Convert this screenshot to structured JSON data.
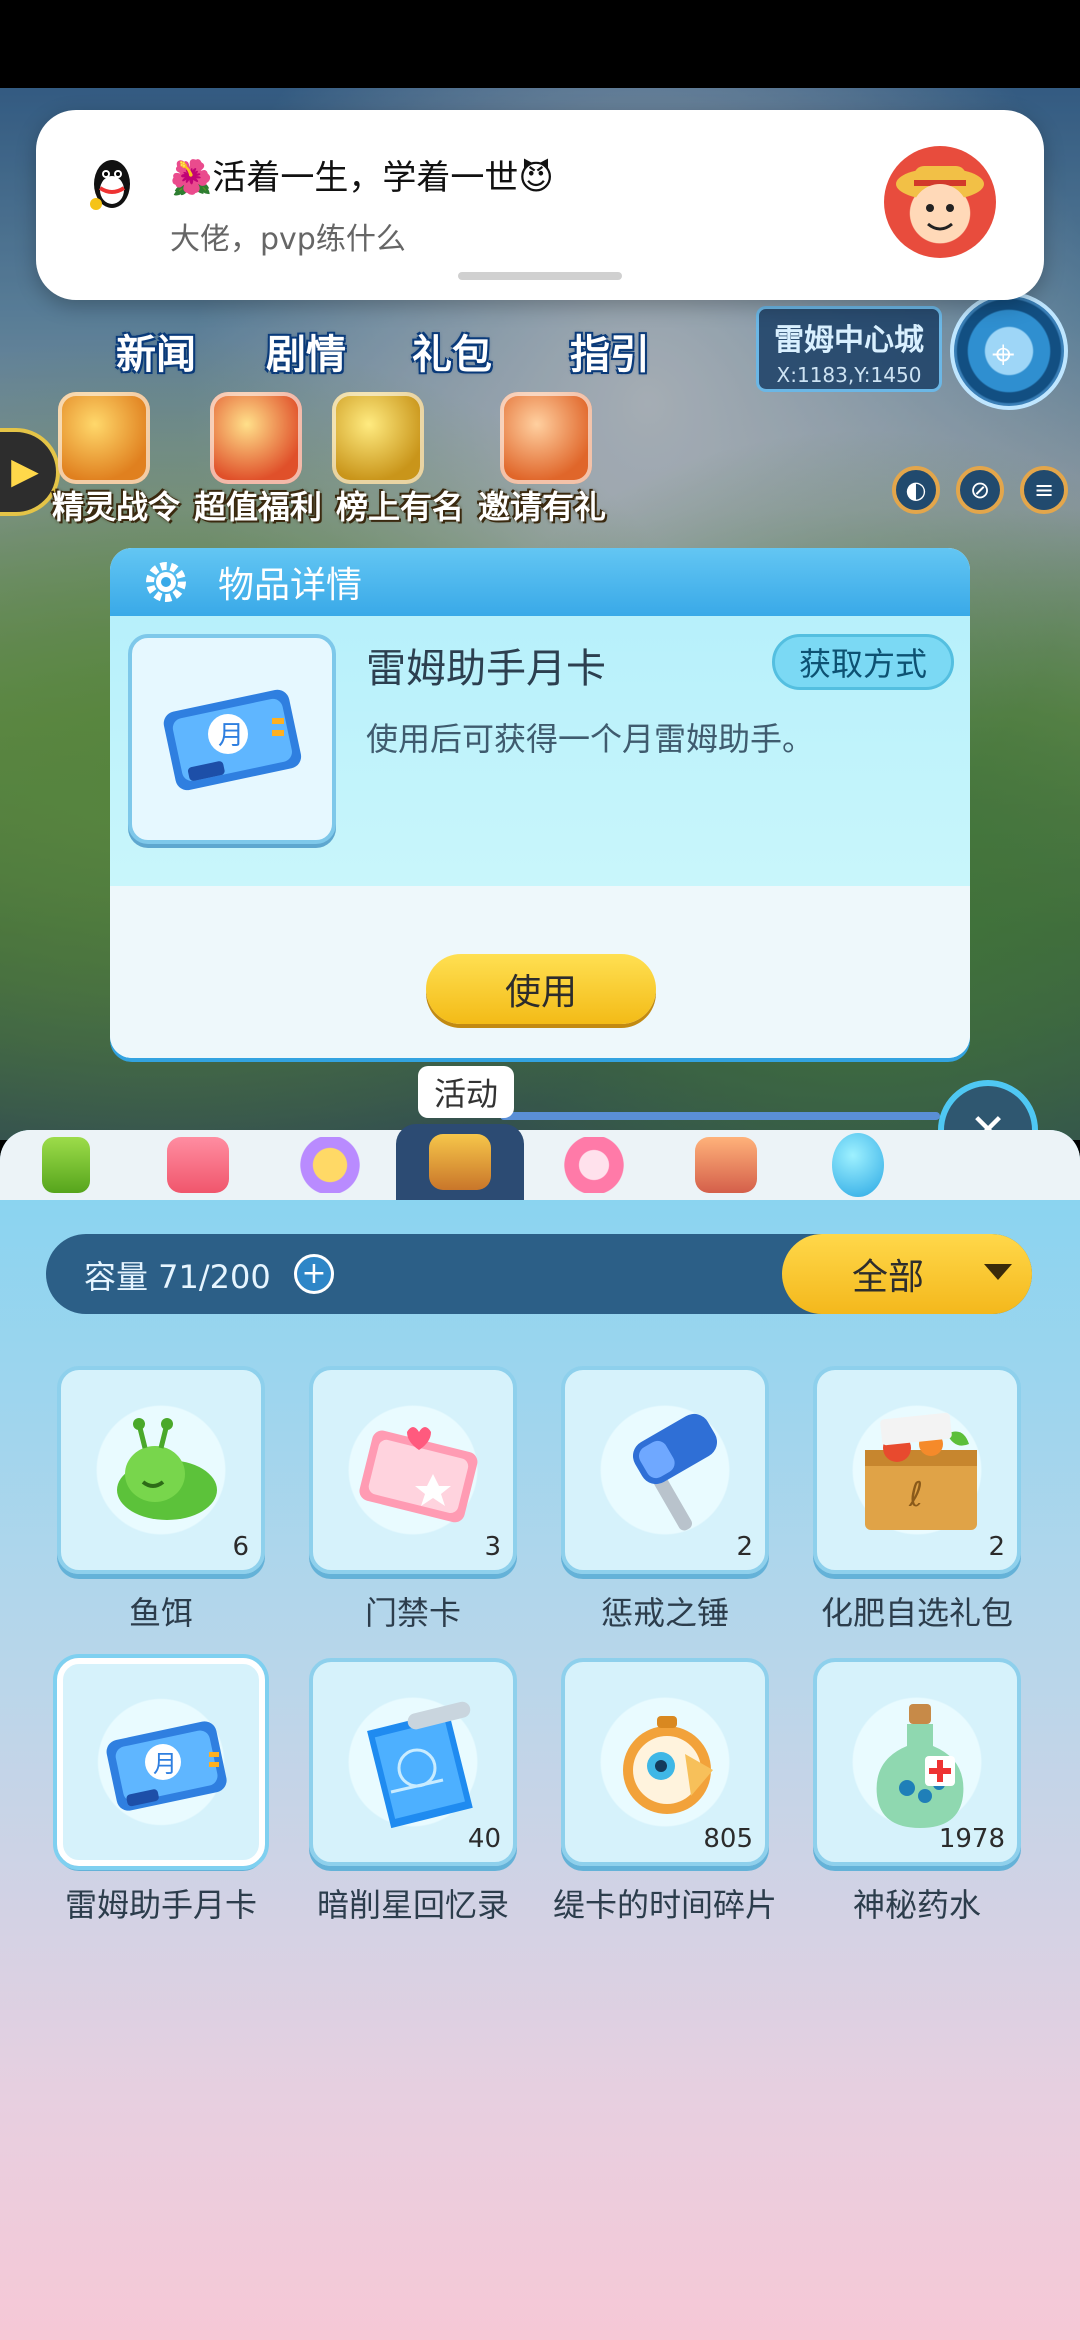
{
  "hud": {
    "top_labels": [
      "新闻",
      "剧情",
      "礼包",
      "指引"
    ],
    "mid_labels": [
      "精灵战令",
      "超值福利",
      "榜上有名",
      "邀请有礼"
    ],
    "location": {
      "name": "雷姆中心城",
      "coords": "X:1183,Y:1450"
    }
  },
  "notification": {
    "title": "🌺活着一生，学着一世😈",
    "text": "大佬，pvp练什么"
  },
  "detail": {
    "header": "物品详情",
    "item_name": "雷姆助手月卡",
    "description": "使用后可获得一个月雷姆助手。",
    "get_method": "获取方式",
    "use_label": "使用",
    "badge": "月"
  },
  "activity_label": "活动",
  "close_symbol": "✕",
  "bag": {
    "capacity": "容量 71/200",
    "filter": "全部",
    "tabs": [
      "battery",
      "gift-box",
      "magic-wand",
      "chest",
      "dress",
      "rocking-horse",
      "egg"
    ],
    "active_tab": 3,
    "items": [
      {
        "name": "鱼饵",
        "count": "6",
        "icon": "slug"
      },
      {
        "name": "门禁卡",
        "count": "3",
        "icon": "access-card"
      },
      {
        "name": "惩戒之锤",
        "count": "2",
        "icon": "hammer"
      },
      {
        "name": "化肥自选礼包",
        "count": "2",
        "icon": "crate"
      },
      {
        "name": "雷姆助手月卡",
        "count": "",
        "icon": "month-card"
      },
      {
        "name": "暗削星回忆录",
        "count": "40",
        "icon": "blueprint"
      },
      {
        "name": "缇卡的时间碎片",
        "count": "805",
        "icon": "clock"
      },
      {
        "name": "神秘药水",
        "count": "1978",
        "icon": "potion"
      }
    ]
  },
  "colors": {
    "accent": "#39a9e8",
    "button_yellow": "#f4b81c",
    "panel_dark": "#2c5f87"
  }
}
